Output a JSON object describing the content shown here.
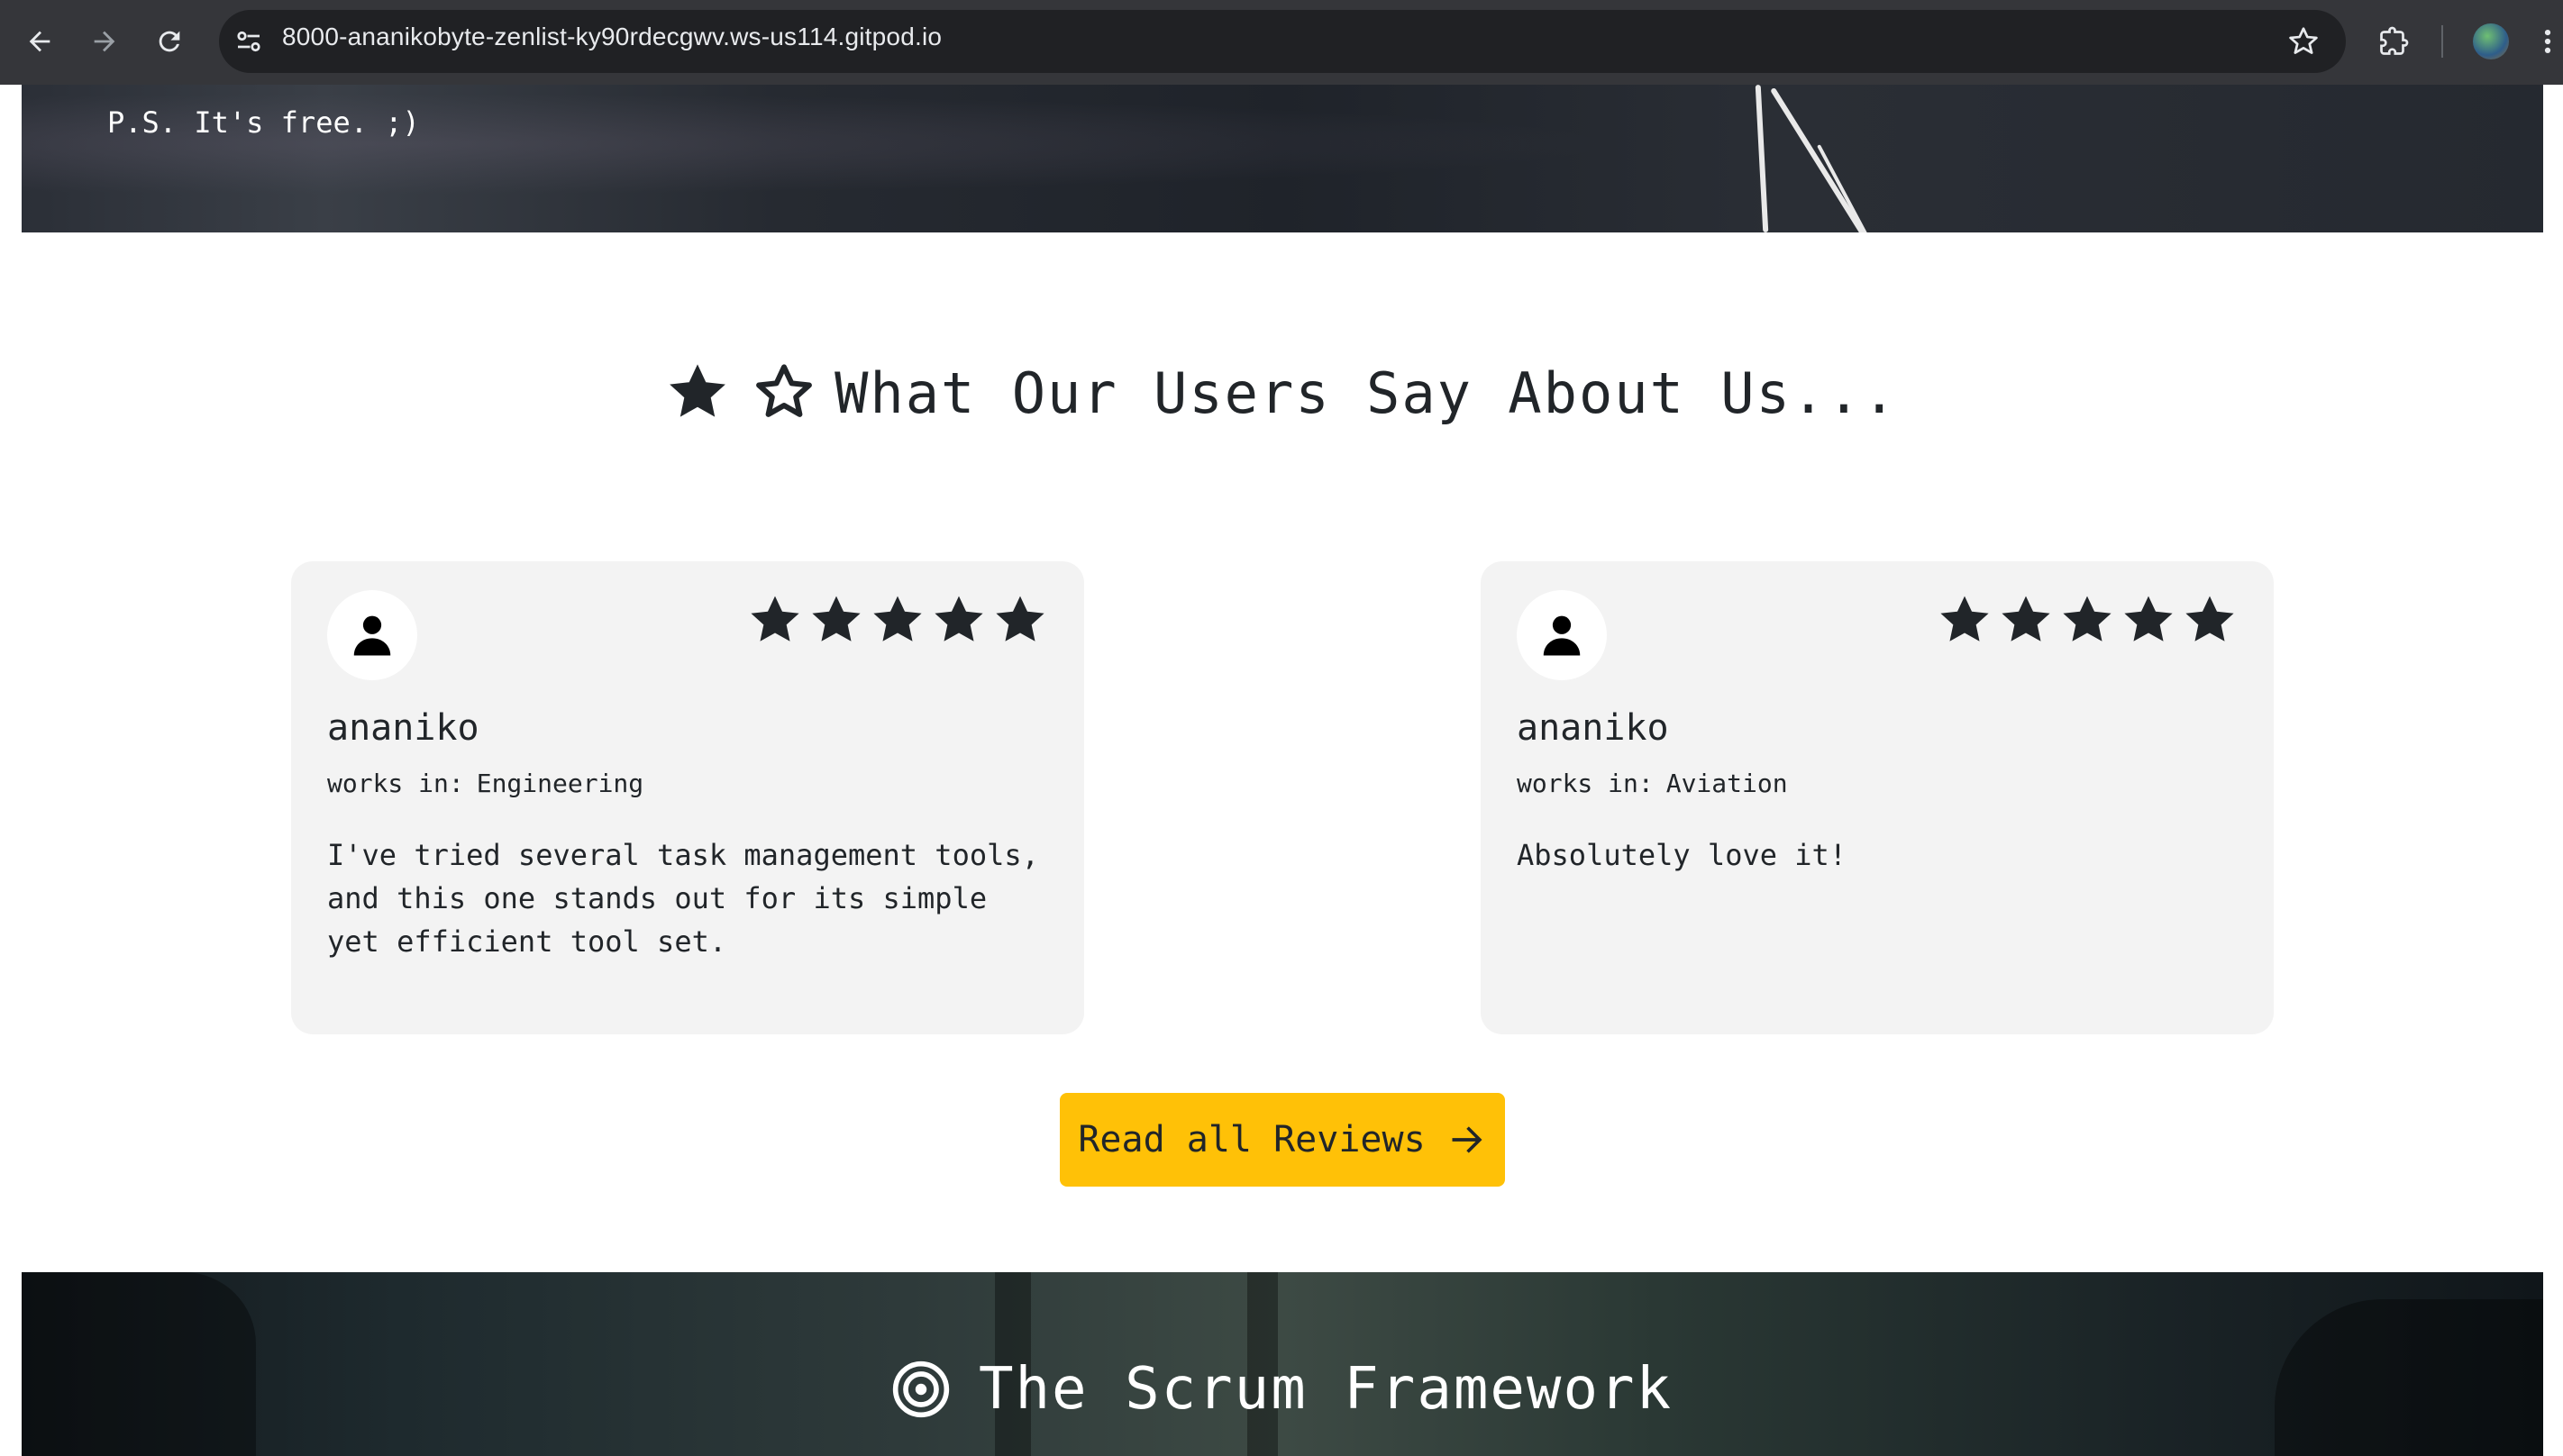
{
  "browser": {
    "url": "8000-ananikobyte-zenlist-ky90rdecgwv.ws-us114.gitpod.io"
  },
  "hero": {
    "ps_text": "P.S. It's free. ;)"
  },
  "reviews_section": {
    "title": "What Our Users Say About Us...",
    "cards": [
      {
        "name": "ananiko",
        "works_prefix": "works in:",
        "works_in": "Engineering",
        "rating": 5,
        "review": "I've tried several task management tools, and this one stands out for its simple yet efficient tool set."
      },
      {
        "name": "ananiko",
        "works_prefix": "works in:",
        "works_in": "Aviation",
        "rating": 5,
        "review": "Absolutely love it!"
      }
    ],
    "button_label": "Read all Reviews"
  },
  "scrum_section": {
    "title": "The Scrum Framework"
  },
  "colors": {
    "accent_button": "#ffc107",
    "card_bg": "#f3f3f3",
    "text": "#212529"
  }
}
